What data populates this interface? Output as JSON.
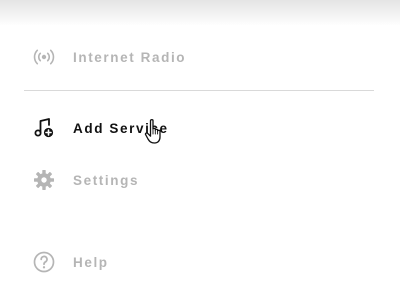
{
  "menu": {
    "items": [
      {
        "label": "Internet Radio",
        "icon": "radio-broadcast-icon",
        "state": "inactive"
      },
      {
        "label": "Add Service",
        "icon": "music-note-add-icon",
        "state": "hover"
      },
      {
        "label": "Settings",
        "icon": "gear-icon",
        "state": "inactive"
      },
      {
        "label": "Help",
        "icon": "question-icon",
        "state": "inactive"
      }
    ]
  },
  "colors": {
    "inactive_text": "#b5b5b5",
    "active_text": "#111111",
    "divider": "#d9d9d9"
  }
}
